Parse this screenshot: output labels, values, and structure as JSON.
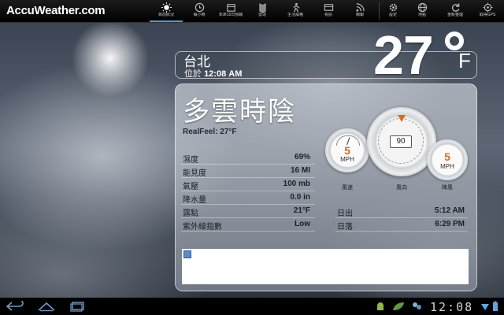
{
  "app": {
    "logo": "AccuWeather.com"
  },
  "nav": {
    "items": [
      {
        "label": "目前狀況",
        "icon": "sun-icon"
      },
      {
        "label": "每小時",
        "icon": "clock-icon"
      },
      {
        "label": "未來15日預報",
        "icon": "calendar-icon"
      },
      {
        "label": "雷達",
        "icon": "radar-icon"
      },
      {
        "label": "生活風格",
        "icon": "runner-icon"
      },
      {
        "label": "視訊",
        "icon": "video-icon"
      },
      {
        "label": "簡報",
        "icon": "rss-icon"
      },
      {
        "label": "設定",
        "icon": "gear-icon"
      },
      {
        "label": "地點",
        "icon": "globe-icon"
      },
      {
        "label": "重新整理",
        "icon": "refresh-icon"
      },
      {
        "label": "取得GPS",
        "icon": "gps-icon"
      }
    ]
  },
  "location": {
    "city": "台北",
    "time_prefix": "位於",
    "time": "12:08 AM"
  },
  "current": {
    "temperature": "27",
    "unit": "F",
    "condition": "多雲時陰",
    "realfeel": "RealFeel: 27°F"
  },
  "details": [
    {
      "label": "濕度",
      "value": "69%"
    },
    {
      "label": "能見度",
      "value": "16 MI"
    },
    {
      "label": "氣壓",
      "value": "100 mb"
    },
    {
      "label": "降水量",
      "value": "0.0 in"
    },
    {
      "label": "露點",
      "value": "21°F"
    },
    {
      "label": "紫外線指數",
      "value": "Low"
    }
  ],
  "sun": [
    {
      "label": "日出",
      "value": "5:12 AM"
    },
    {
      "label": "日落",
      "value": "6:29 PM"
    }
  ],
  "gauges": {
    "wind_speed": {
      "value": "5",
      "unit": "MPH",
      "label": "風速"
    },
    "wind_direction": {
      "value": "90",
      "label": "風向"
    },
    "gust": {
      "value": "5",
      "unit": "MPH",
      "label": "陣風"
    }
  },
  "statusbar": {
    "clock": "12:08"
  },
  "colors": {
    "accent": "#3aa3d8",
    "gauge_value": "#e06a1a"
  }
}
